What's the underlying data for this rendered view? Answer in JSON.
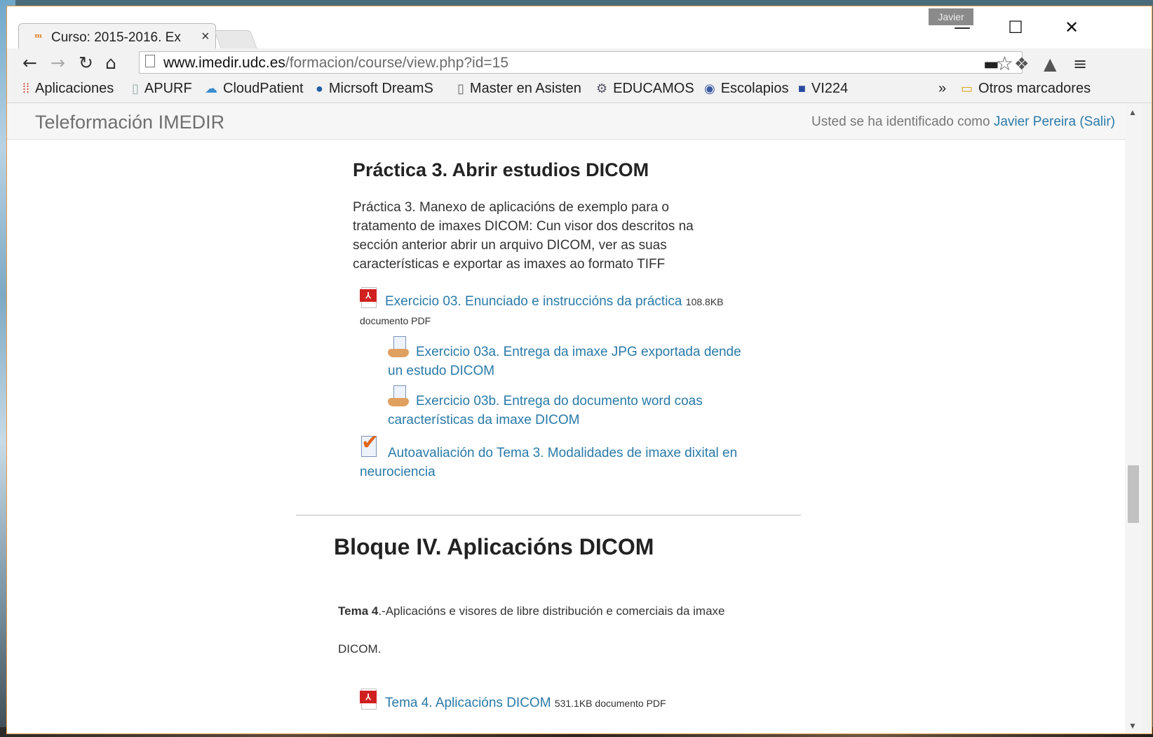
{
  "browser": {
    "tab_title": "Curso: 2015-2016. Ex",
    "tab_close": "×",
    "profile_name": "Javier",
    "url_host": "www.imedir.udc.es",
    "url_path": "/formacion/course/view.php?id=15"
  },
  "bookmarks": [
    {
      "icon": "apps-grid-icon",
      "label": "Aplicaciones"
    },
    {
      "icon": "page-icon",
      "label": "APURF"
    },
    {
      "icon": "cloud-icon",
      "label": "CloudPatient"
    },
    {
      "icon": "dreamspark-icon",
      "label": "Micrsoft DreamSp"
    },
    {
      "icon": "page-icon",
      "label": "Master en Asisten"
    },
    {
      "icon": "gear-icon",
      "label": "EDUCAMOS"
    },
    {
      "icon": "circle-icon",
      "label": "Escolapios"
    },
    {
      "icon": "square-logo-icon",
      "label": "VI224"
    }
  ],
  "bookmarks_overflow": "»",
  "bookmarks_other": "Otros marcadores",
  "site": {
    "title": "Teleformación IMEDIR",
    "login_prefix": "Usted se ha identificado como",
    "user_name": "Javier Pereira",
    "logout_open": "(",
    "logout": "Salir",
    "logout_close": ")"
  },
  "section3": {
    "heading": "Práctica 3. Abrir estudios DICOM",
    "summary": "Práctica 3. Manexo de aplicacións de exemplo para o tratamento de imaxes DICOM: Cun visor dos descritos na sección anterior abrir un arquivo DICOM, ver as suas características e exportar as imaxes ao formato TIFF",
    "resource_link": "Exercicio 03. Enunciado e instruccións da práctica",
    "resource_size": "108.8KB",
    "resource_type": "documento PDF",
    "assignment_a": "Exercicio 03a. Entrega da imaxe JPG exportada dende un estudo DICOM",
    "assignment_b": "Exercicio 03b. Entrega do documento word coas características da imaxe DICOM",
    "quiz": "Autoavaliación do Tema 3. Modalidades de imaxe dixital en neurociencia"
  },
  "block4": {
    "heading": "Bloque IV. Aplicacións DICOM",
    "tema_label": "Tema 4",
    "tema_text": ".-Aplicacións e visores de libre distribución e comerciais da imaxe",
    "tema_text2": "DICOM.",
    "resource_link": "Tema 4. Aplicacións DICOM",
    "resource_meta": "531.1KB documento PDF"
  },
  "colors": {
    "link": "#2a7aa8",
    "accent_border": "#e39a48"
  }
}
